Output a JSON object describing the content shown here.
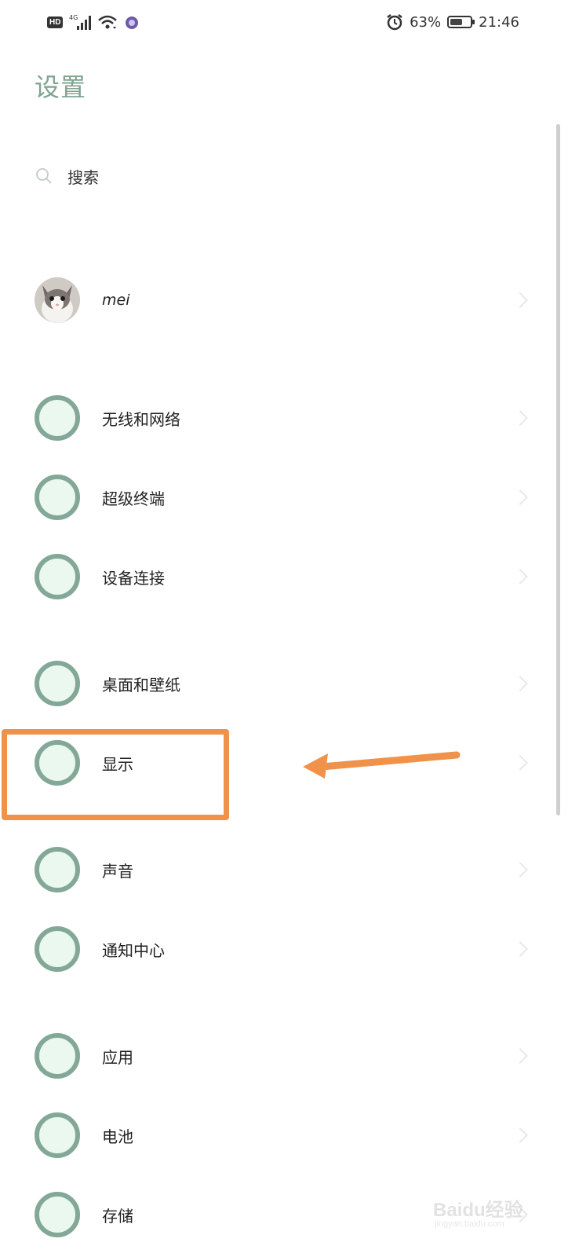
{
  "status_bar": {
    "hd": "HD",
    "network": "4G",
    "battery_percent": "63%",
    "battery_level": 0.63,
    "time": "21:46"
  },
  "page": {
    "title": "设置"
  },
  "search": {
    "label": "搜索"
  },
  "account": {
    "name": "mei"
  },
  "items": [
    {
      "label": "无线和网络",
      "icon": "wireless-network-icon"
    },
    {
      "label": "超级终端",
      "icon": "super-device-icon"
    },
    {
      "label": "设备连接",
      "icon": "device-connection-icon"
    },
    {
      "label": "桌面和壁纸",
      "icon": "home-wallpaper-icon"
    },
    {
      "label": "显示",
      "icon": "display-icon"
    },
    {
      "label": "声音",
      "icon": "sound-icon"
    },
    {
      "label": "通知中心",
      "icon": "notification-center-icon"
    },
    {
      "label": "应用",
      "icon": "apps-icon"
    },
    {
      "label": "电池",
      "icon": "battery-icon"
    },
    {
      "label": "存储",
      "icon": "storage-icon"
    }
  ],
  "colors": {
    "title": "#7ea38f",
    "icon_ring": "#84a898",
    "icon_fill": "#ebf8f0",
    "highlight": "#f0924a"
  },
  "watermark": {
    "text": "Baidu经验",
    "sub": "jingyan.baidu.com"
  }
}
